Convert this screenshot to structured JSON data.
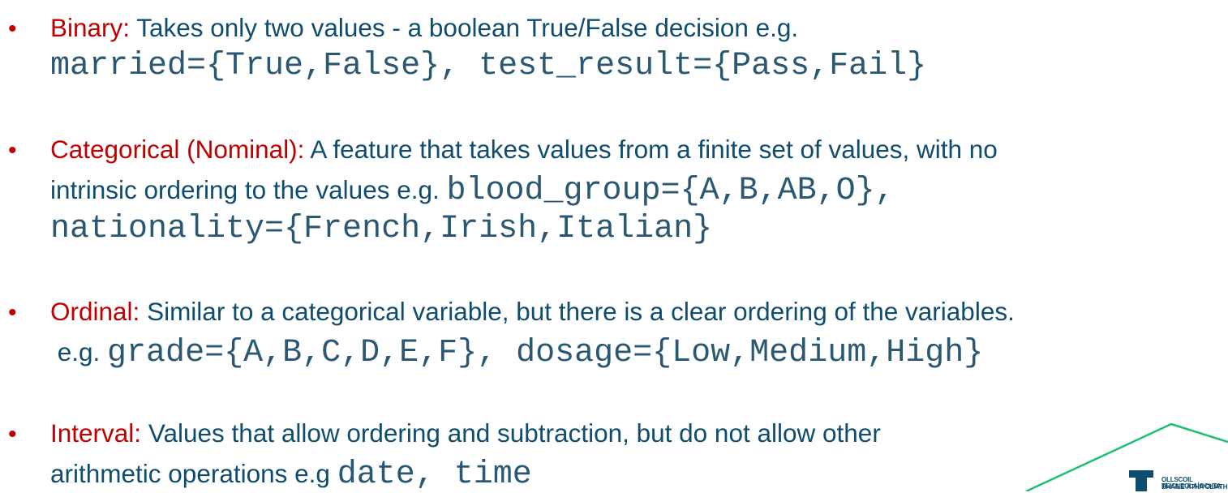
{
  "items": [
    {
      "term": "Binary:",
      "lines": [
        [
          {
            "t": "Takes only two values - a boolean True/False decision e.g."
          }
        ],
        [
          {
            "c": "married={True,False}, test_result={Pass,Fail}"
          }
        ]
      ]
    },
    {
      "term": "Categorical (Nominal):",
      "lines": [
        [
          {
            "t": "A feature that takes values from a finite set of values, with no"
          }
        ],
        [
          {
            "t": "intrinsic ordering to the values e.g. "
          },
          {
            "c": "blood_group={A,B,AB,O},"
          }
        ],
        [
          {
            "c": "nationality={French,Irish,Italian}"
          }
        ]
      ]
    },
    {
      "term": "Ordinal:",
      "lines": [
        [
          {
            "t": "Similar to a categorical variable, but there is a clear ordering of the variables."
          }
        ],
        [
          {
            "t": " e.g. "
          },
          {
            "c": "grade={A,B,C,D,E,F}, dosage={Low,Medium,High}"
          }
        ]
      ]
    },
    {
      "term": "Interval:",
      "lines": [
        [
          {
            "t": "Values that allow ordering and subtraction, but do not allow other"
          }
        ],
        [
          {
            "t": "arithmetic operations e.g "
          },
          {
            "c": "date, time"
          }
        ]
      ]
    }
  ],
  "logo": {
    "line1": "OLLSCOIL TEICNEOLAÍOCHTA",
    "line2": "BHAILE ÁTHA CLIATH"
  },
  "colors": {
    "term": "#C00000",
    "text": "#0E4D6E",
    "code": "#2A5873",
    "accent_line": "#1DBF73"
  },
  "icons": {
    "bullet": "bullet-dot",
    "logo": "tu-dublin-logo"
  }
}
